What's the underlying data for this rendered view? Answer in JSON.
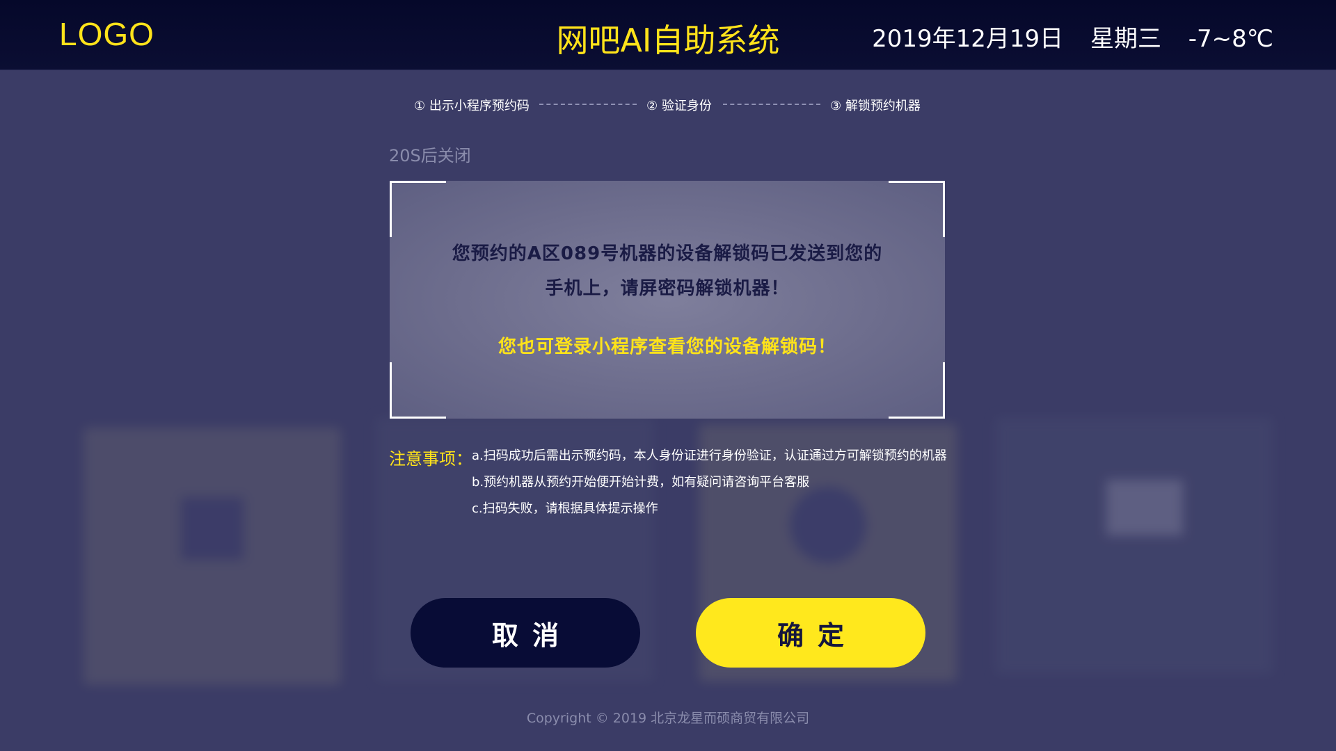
{
  "header": {
    "logo": "LOGO",
    "title": "网吧AI自助系统",
    "date": "2019年12月19日",
    "weekday": "星期三",
    "temperature": "-7~8℃"
  },
  "steps": [
    {
      "label": "① 出示小程序预约码"
    },
    {
      "label": "② 验证身份"
    },
    {
      "label": "③ 解锁预约机器"
    }
  ],
  "countdown": "20S后关闭",
  "message": {
    "line1": "您预约的A区089号机器的设备解锁码已发送到您的",
    "line2": "手机上，请屏密码解锁机器！",
    "highlight": "您也可登录小程序查看您的设备解锁码！"
  },
  "notes": {
    "title": "注意事项：",
    "items": [
      "a.扫码成功后需出示预约码，本人身份证进行身份验证，认证通过方可解锁预约的机器",
      "b.预约机器从预约开始便开始计费，如有疑问请咨询平台客服",
      "c.扫码失败，请根据具体提示操作"
    ]
  },
  "buttons": {
    "cancel": "取消",
    "confirm": "确定"
  },
  "footer": "Copyright © 2019  北京龙星而硕商贸有限公司",
  "colors": {
    "accent": "#ffe31a",
    "background": "#3b3c66",
    "header_bg": "#05082a",
    "cancel_bg": "#080c36",
    "confirm_bg": "#ffe81d"
  }
}
